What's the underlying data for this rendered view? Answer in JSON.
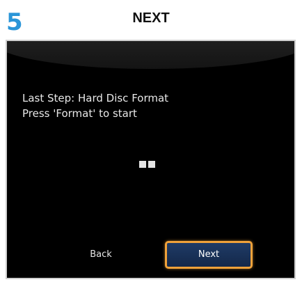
{
  "header": {
    "step_number": "5",
    "title": "NEXT"
  },
  "screen": {
    "message_line1": "Last Step: Hard Disc Format",
    "message_line2": "Press 'Format' to start",
    "progress_indicator": "two small squares",
    "buttons": {
      "back_label": "Back",
      "next_label": "Next"
    },
    "focused_button": "Next"
  },
  "colors": {
    "step_number": "#2a95d8",
    "screen_background": "#000000",
    "focus_border": "#f0a23a",
    "next_button_fill": "#1f3b66"
  }
}
